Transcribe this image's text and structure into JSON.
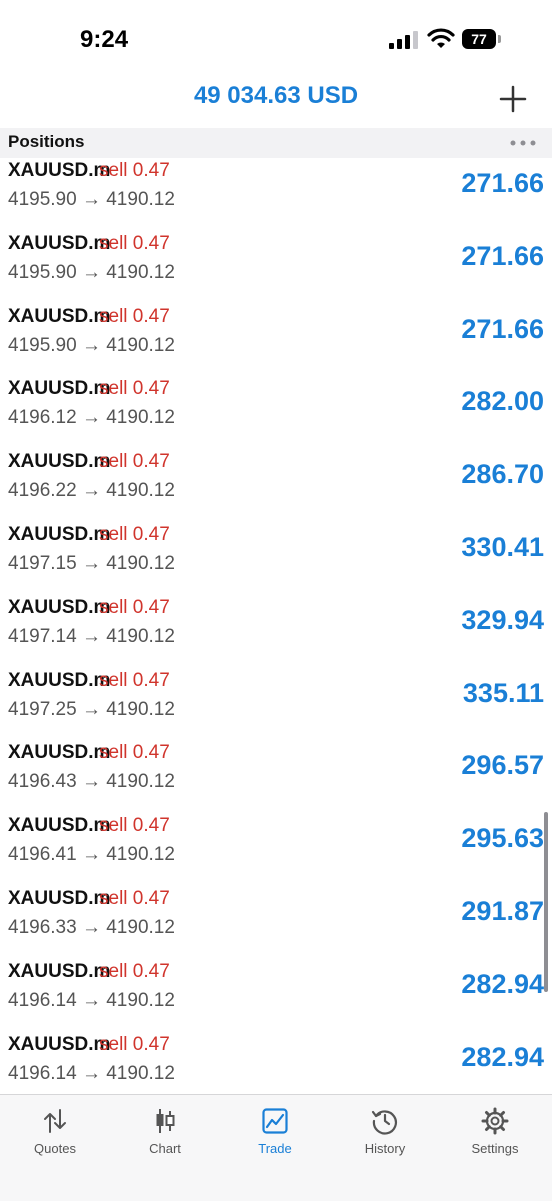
{
  "status_bar": {
    "time": "9:24",
    "battery": "77"
  },
  "header": {
    "balance": "49 034.63 USD"
  },
  "section": {
    "title": "Positions"
  },
  "positions": [
    {
      "symbol": "XAUUSD.m",
      "side": "sell 0.47",
      "prices": "4195.90 → 4190.12",
      "profit": "271.66"
    },
    {
      "symbol": "XAUUSD.m",
      "side": "sell 0.47",
      "prices": "4195.90 → 4190.12",
      "profit": "271.66"
    },
    {
      "symbol": "XAUUSD.m",
      "side": "sell 0.47",
      "prices": "4195.90 → 4190.12",
      "profit": "271.66"
    },
    {
      "symbol": "XAUUSD.m",
      "side": "sell 0.47",
      "prices": "4196.12 → 4190.12",
      "profit": "282.00"
    },
    {
      "symbol": "XAUUSD.m",
      "side": "sell 0.47",
      "prices": "4196.22 → 4190.12",
      "profit": "286.70"
    },
    {
      "symbol": "XAUUSD.m",
      "side": "sell 0.47",
      "prices": "4197.15 → 4190.12",
      "profit": "330.41"
    },
    {
      "symbol": "XAUUSD.m",
      "side": "sell 0.47",
      "prices": "4197.14 → 4190.12",
      "profit": "329.94"
    },
    {
      "symbol": "XAUUSD.m",
      "side": "sell 0.47",
      "prices": "4197.25 → 4190.12",
      "profit": "335.11"
    },
    {
      "symbol": "XAUUSD.m",
      "side": "sell 0.47",
      "prices": "4196.43 → 4190.12",
      "profit": "296.57"
    },
    {
      "symbol": "XAUUSD.m",
      "side": "sell 0.47",
      "prices": "4196.41 → 4190.12",
      "profit": "295.63"
    },
    {
      "symbol": "XAUUSD.m",
      "side": "sell 0.47",
      "prices": "4196.33 → 4190.12",
      "profit": "291.87"
    },
    {
      "symbol": "XAUUSD.m",
      "side": "sell 0.47",
      "prices": "4196.14 → 4190.12",
      "profit": "282.94"
    },
    {
      "symbol": "XAUUSD.m",
      "side": "sell 0.47",
      "prices": "4196.14 → 4190.12",
      "profit": "282.94"
    }
  ],
  "tabs": [
    {
      "label": "Quotes",
      "icon": "quotes-arrows-icon",
      "active": false
    },
    {
      "label": "Chart",
      "icon": "candlestick-chart-icon",
      "active": false
    },
    {
      "label": "Trade",
      "icon": "trade-chart-icon",
      "active": true
    },
    {
      "label": "History",
      "icon": "history-clock-icon",
      "active": false
    },
    {
      "label": "Settings",
      "icon": "gear-icon",
      "active": false
    }
  ],
  "colors": {
    "accent": "#1a7fd6",
    "sell": "#d0342c"
  }
}
